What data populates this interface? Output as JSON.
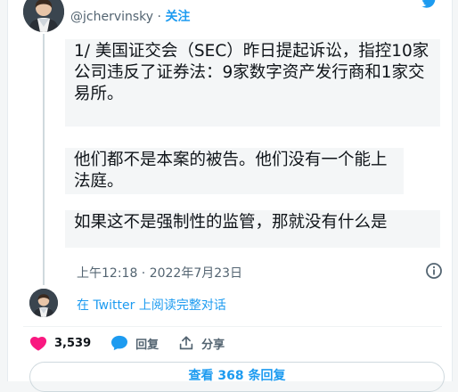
{
  "author": {
    "handle": "@jchervinsky",
    "separator": "·",
    "follow_label": "关注"
  },
  "tweet": {
    "paragraphs": [
      "1/ 美国证交会（SEC）昨日提起诉讼，指控10家公司违反了证券法：9家数字资产发行商和1家交易所。",
      "他们都不是本案的被告。他们没有一个能上法庭。",
      "如果这不是强制性的监管，那就没有什么是"
    ],
    "timestamp": "上午12:18 · 2022年7月23日"
  },
  "thread": {
    "read_link": "在 Twitter 上阅读完整对话"
  },
  "actions": {
    "likes": "3,539",
    "reply_label": "回复",
    "share_label": "分享"
  },
  "footer": {
    "view_replies": "查看 368 条回复"
  },
  "colors": {
    "accent": "#1d9bf0",
    "like": "#f91880",
    "text_secondary": "#536471"
  },
  "icons": [
    "twitter-bird-icon",
    "info-icon",
    "heart-icon",
    "reply-bubble-icon",
    "share-icon"
  ]
}
